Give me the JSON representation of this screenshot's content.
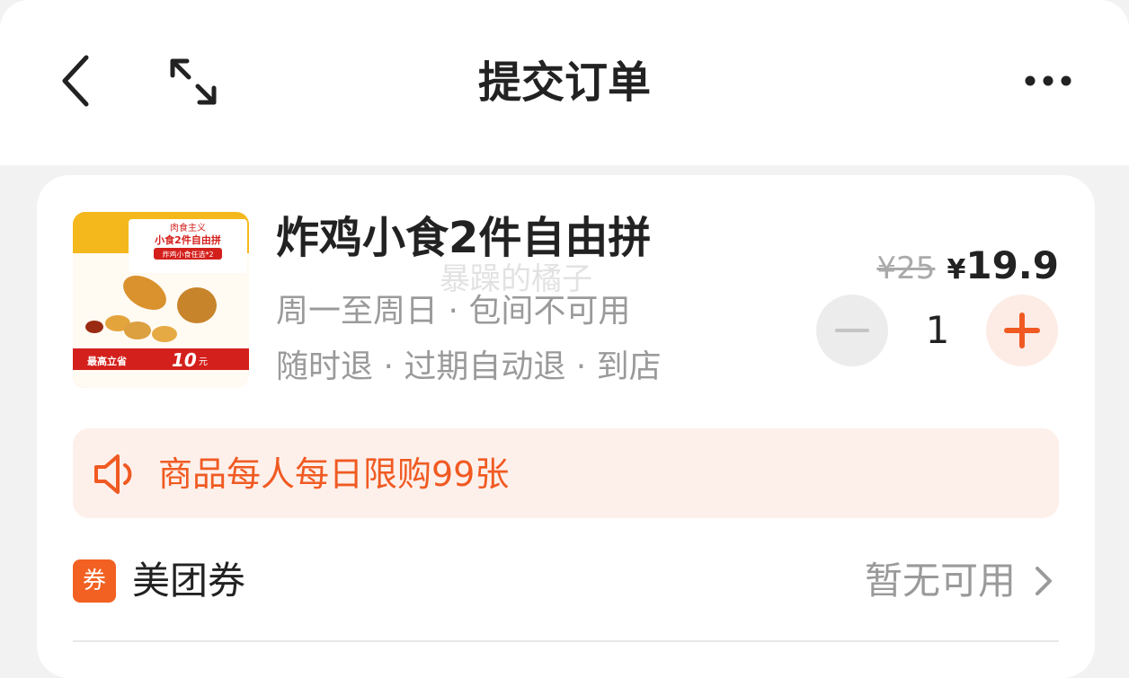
{
  "header": {
    "title": "提交订单",
    "back_icon": "chevron-left-icon",
    "expand_icon": "expand-icon",
    "more_icon": "more-horizontal-icon"
  },
  "product": {
    "name": "炸鸡小食2件自由拼",
    "watermark": "暴躁的橘子",
    "schedule": "周一至周日 · 包间不可用",
    "policy": "随时退 · 过期自动退 · 到店",
    "original_price": "¥25",
    "price_symbol": "¥",
    "price": "19.9",
    "quantity": "1",
    "image": {
      "banner_top": "肉食主义",
      "banner_main": "小食2件自由拼",
      "banner_sub": "炸鸡小食任选*2",
      "save_label": "最高立省",
      "save_amount": "10",
      "save_unit": "元"
    }
  },
  "notice": {
    "text": "商品每人每日限购99张",
    "icon": "speaker-icon"
  },
  "coupon": {
    "badge": "券",
    "label": "美团券",
    "status": "暂无可用"
  },
  "colors": {
    "accent": "#f05a22",
    "notice_bg": "#fdf0eb",
    "page_bg": "#f2f2f2"
  }
}
